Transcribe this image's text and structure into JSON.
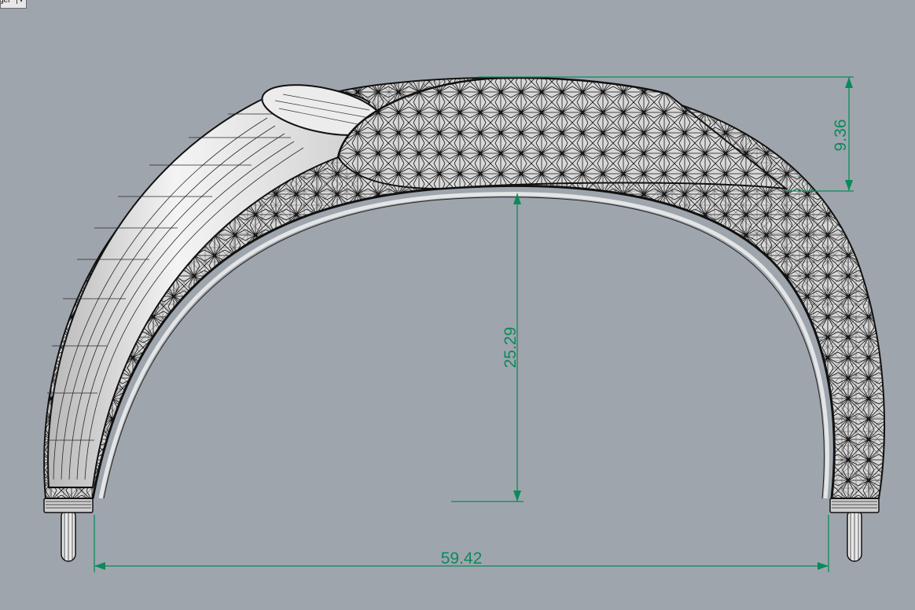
{
  "viewport": {
    "tab_label": "ger",
    "tab_arrow": "▾"
  },
  "colors": {
    "background": "#9ea5ad",
    "dimension": "#0a8a5a",
    "wire": "#1c1c1c",
    "surface": "#e6e6e6"
  },
  "dimensions": {
    "height_top": "9.36",
    "inner_height": "25.29",
    "width": "59.42"
  }
}
